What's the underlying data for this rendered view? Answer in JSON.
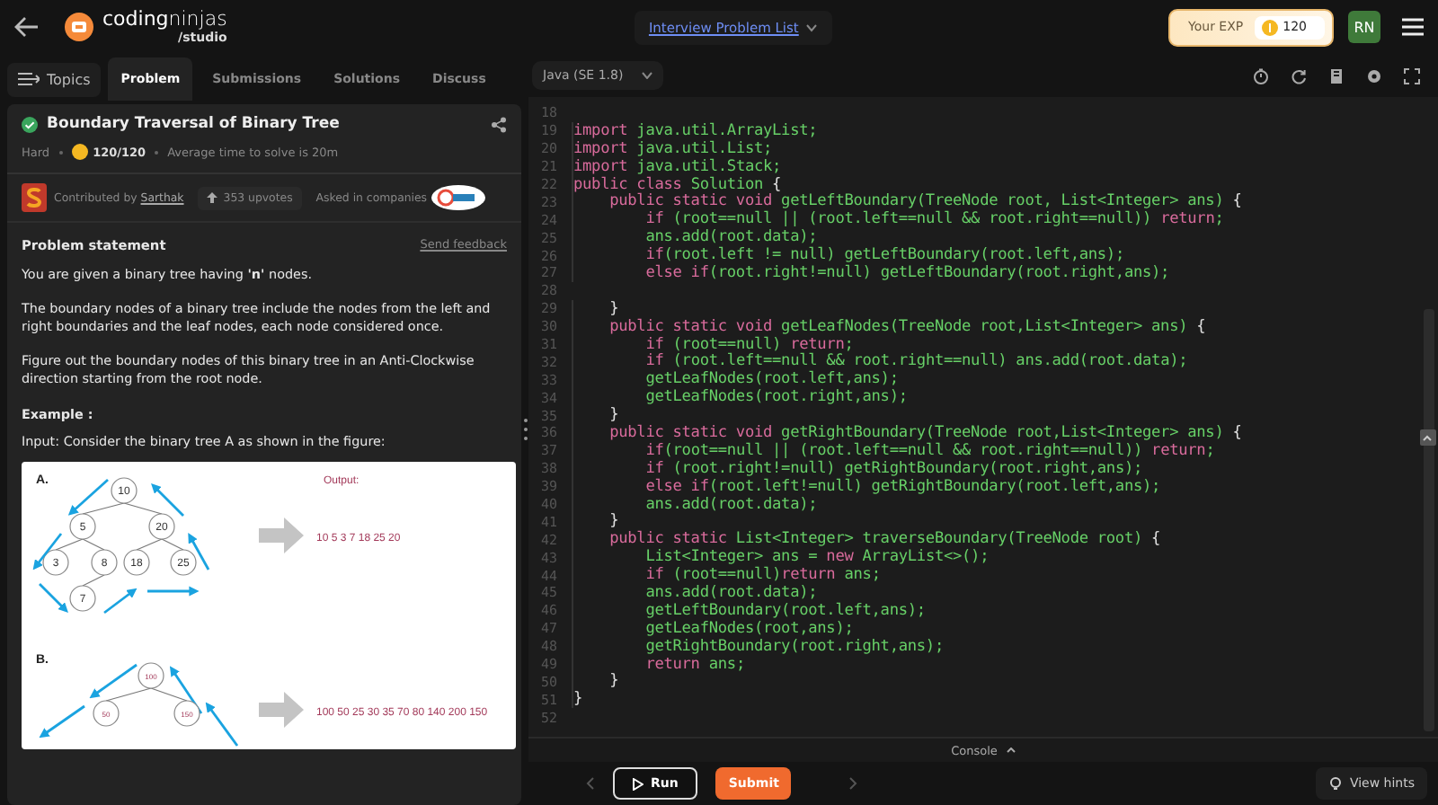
{
  "header": {
    "logo": "**coding**ninjas",
    "logo_sub": "/studio",
    "breadcrumb": "Interview Problem List",
    "exp_label": "Your EXP",
    "exp_value": "120",
    "avatar": "RN"
  },
  "nav": {
    "topics": "Topics",
    "tabs": [
      {
        "label": "Problem",
        "selected": true
      },
      {
        "label": "Submissions",
        "selected": false
      },
      {
        "label": "Solutions",
        "selected": false
      },
      {
        "label": "Discuss",
        "selected": false
      }
    ]
  },
  "problem": {
    "title": "Boundary Traversal of Binary Tree",
    "solved": true,
    "difficulty": "Hard",
    "score": "120/120",
    "avg_time": "Average time to solve is 20m",
    "contributed_by": "Contributed by",
    "author": "Sarthak",
    "upvotes": "353 upvotes",
    "asked_in": "Asked in companies",
    "statement_heading": "Problem statement",
    "feedback": "Send feedback",
    "paragraphs": [
      "You are given a binary tree having **'n'** nodes.",
      "The boundary nodes of a binary tree include the nodes from the left and right boundaries and the leaf nodes, each node considered once.",
      "Figure out the boundary nodes of this binary tree in an Anti-Clockwise direction starting from the root node."
    ],
    "example_heading": "Example :",
    "input_text": "Input: Consider the binary tree A as shown in the figure:",
    "figure": {
      "label_a": "A.",
      "output_label": "Output:",
      "nodes_a": [
        "10",
        "5",
        "20",
        "3",
        "8",
        "18",
        "25",
        "7"
      ],
      "output_a": "10  5  3  7  18  25  20",
      "label_b": "B.",
      "nodes_b": [
        "100",
        "50",
        "150"
      ],
      "output_b": "100  50  25  30  35  70  80  140  200  150"
    }
  },
  "editor": {
    "language": "Java (SE 1.8)",
    "lines": [
      {
        "number": "18"
      },
      {
        "number": "19",
        "tokens": [
          {
            "kind": "kw",
            "text": "import"
          },
          {
            "kind": "id",
            "text": " java.util.ArrayList;"
          }
        ]
      },
      {
        "number": "20",
        "tokens": [
          {
            "kind": "kw",
            "text": "import"
          },
          {
            "kind": "id",
            "text": " java.util.List;"
          }
        ]
      },
      {
        "number": "21",
        "tokens": [
          {
            "kind": "kw",
            "text": "import"
          },
          {
            "kind": "id",
            "text": " java.util.Stack;"
          }
        ]
      },
      {
        "number": "22",
        "tokens": [
          {
            "kind": "kw",
            "text": "public class"
          },
          {
            "kind": "id",
            "text": " Solution "
          },
          {
            "kind": "p",
            "text": "{"
          }
        ]
      },
      {
        "number": "23",
        "tokens": [
          {
            "kind": "kw",
            "text": "    public static void"
          },
          {
            "kind": "id",
            "text": " getLeftBoundary(TreeNode root, List<Integer> ans) "
          },
          {
            "kind": "p",
            "text": "{"
          }
        ]
      },
      {
        "number": "24",
        "tokens": [
          {
            "kind": "kw",
            "text": "        if"
          },
          {
            "kind": "id",
            "text": " (root==null || (root.left==null && root.right==null)) "
          },
          {
            "kind": "kw",
            "text": "return"
          },
          {
            "kind": "id",
            "text": ";"
          }
        ]
      },
      {
        "number": "25",
        "tokens": [
          {
            "kind": "id",
            "text": "        ans.add(root.data);"
          }
        ]
      },
      {
        "number": "26",
        "tokens": [
          {
            "kind": "kw",
            "text": "        if"
          },
          {
            "kind": "id",
            "text": "(root.left != null) getLeftBoundary(root.left,ans);"
          }
        ]
      },
      {
        "number": "27",
        "tokens": [
          {
            "kind": "kw",
            "text": "        else if"
          },
          {
            "kind": "id",
            "text": "(root.right!=null) getLeftBoundary(root.right,ans);"
          }
        ]
      },
      {
        "number": "28"
      },
      {
        "number": "29",
        "tokens": [
          {
            "kind": "p",
            "text": "    }"
          }
        ]
      },
      {
        "number": "30",
        "tokens": [
          {
            "kind": "kw",
            "text": "    public static void"
          },
          {
            "kind": "id",
            "text": " getLeafNodes(TreeNode root,List<Integer> ans) "
          },
          {
            "kind": "p",
            "text": "{"
          }
        ]
      },
      {
        "number": "31",
        "tokens": [
          {
            "kind": "kw",
            "text": "        if"
          },
          {
            "kind": "id",
            "text": " (root==null) "
          },
          {
            "kind": "kw",
            "text": "return"
          },
          {
            "kind": "id",
            "text": ";"
          }
        ]
      },
      {
        "number": "32",
        "tokens": [
          {
            "kind": "kw",
            "text": "        if"
          },
          {
            "kind": "id",
            "text": " (root.left==null && root.right==null) ans.add(root.data);"
          }
        ]
      },
      {
        "number": "33",
        "tokens": [
          {
            "kind": "id",
            "text": "        getLeafNodes(root.left,ans);"
          }
        ]
      },
      {
        "number": "34",
        "tokens": [
          {
            "kind": "id",
            "text": "        getLeafNodes(root.right,ans);"
          }
        ]
      },
      {
        "number": "35",
        "tokens": [
          {
            "kind": "p",
            "text": "    }"
          }
        ]
      },
      {
        "number": "36",
        "tokens": [
          {
            "kind": "kw",
            "text": "    public static void"
          },
          {
            "kind": "id",
            "text": " getRightBoundary(TreeNode root,List<Integer> ans) "
          },
          {
            "kind": "p",
            "text": "{"
          }
        ]
      },
      {
        "number": "37",
        "tokens": [
          {
            "kind": "kw",
            "text": "        if"
          },
          {
            "kind": "id",
            "text": "(root==null || (root.left==null && root.right==null)) "
          },
          {
            "kind": "kw",
            "text": "return"
          },
          {
            "kind": "id",
            "text": ";"
          }
        ]
      },
      {
        "number": "38",
        "tokens": [
          {
            "kind": "kw",
            "text": "        if"
          },
          {
            "kind": "id",
            "text": " (root.right!=null) getRightBoundary(root.right,ans);"
          }
        ]
      },
      {
        "number": "39",
        "tokens": [
          {
            "kind": "kw",
            "text": "        else if"
          },
          {
            "kind": "id",
            "text": "(root.left!=null) getRightBoundary(root.left,ans);"
          }
        ]
      },
      {
        "number": "40",
        "tokens": [
          {
            "kind": "id",
            "text": "        ans.add(root.data);"
          }
        ]
      },
      {
        "number": "41",
        "tokens": [
          {
            "kind": "p",
            "text": "    }"
          }
        ]
      },
      {
        "number": "42",
        "tokens": [
          {
            "kind": "kw",
            "text": "    public static"
          },
          {
            "kind": "id",
            "text": " List<Integer> traverseBoundary(TreeNode root) "
          },
          {
            "kind": "p",
            "text": "{"
          }
        ]
      },
      {
        "number": "43",
        "tokens": [
          {
            "kind": "id",
            "text": "        List<Integer> ans = "
          },
          {
            "kind": "kw",
            "text": "new"
          },
          {
            "kind": "id",
            "text": " ArrayList<>();"
          }
        ]
      },
      {
        "number": "44",
        "tokens": [
          {
            "kind": "kw",
            "text": "        if"
          },
          {
            "kind": "id",
            "text": " (root==null)"
          },
          {
            "kind": "kw",
            "text": "return"
          },
          {
            "kind": "id",
            "text": " ans;"
          }
        ]
      },
      {
        "number": "45",
        "tokens": [
          {
            "kind": "id",
            "text": "        ans.add(root.data);"
          }
        ]
      },
      {
        "number": "46",
        "tokens": [
          {
            "kind": "id",
            "text": "        getLeftBoundary(root.left,ans);"
          }
        ]
      },
      {
        "number": "47",
        "tokens": [
          {
            "kind": "id",
            "text": "        getLeafNodes(root,ans);"
          }
        ]
      },
      {
        "number": "48",
        "tokens": [
          {
            "kind": "id",
            "text": "        getRightBoundary(root.right,ans);"
          }
        ]
      },
      {
        "number": "49",
        "tokens": [
          {
            "kind": "kw",
            "text": "        return"
          },
          {
            "kind": "id",
            "text": " ans;"
          }
        ]
      },
      {
        "number": "50",
        "tokens": [
          {
            "kind": "p",
            "text": "    }"
          }
        ]
      },
      {
        "number": "51",
        "tokens": [
          {
            "kind": "p",
            "text": "}"
          }
        ]
      },
      {
        "number": "52"
      }
    ],
    "console": "Console"
  },
  "footer": {
    "run": "Run",
    "submit": "Submit",
    "hints": "View hints"
  }
}
